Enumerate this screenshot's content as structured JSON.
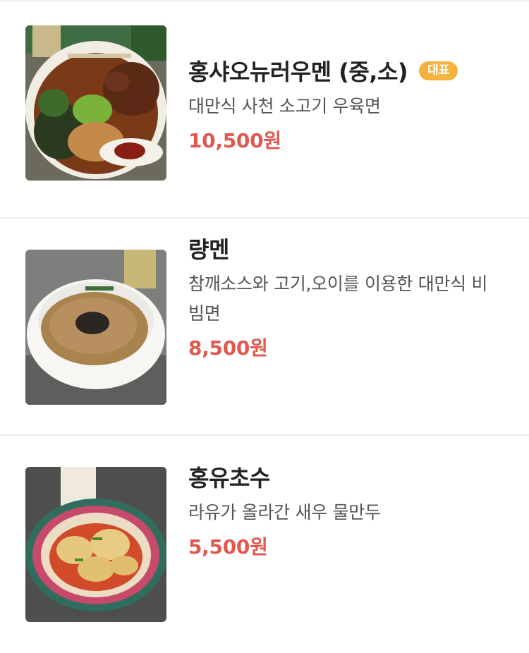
{
  "menu": {
    "items": [
      {
        "name": "홍샤오뉴러우멘 (중,소)",
        "badge": "대표",
        "description": "대만식 사천 소고기 우육면",
        "price": "10,500원",
        "image": "beef-noodle-soup-photo"
      },
      {
        "name": "량멘",
        "description": "참깨소스와 고기,오이를 이용한 대만식 비빔면",
        "price": "8,500원",
        "image": "sesame-cold-noodle-photo"
      },
      {
        "name": "홍유초수",
        "description": "라유가 올라간 새우 물만두",
        "price": "5,500원",
        "image": "chili-oil-shrimp-wonton-photo"
      }
    ]
  },
  "colors": {
    "price": "#e0584e",
    "badge": "#f5b23c",
    "name": "#222222",
    "description": "#555555",
    "divider": "#ececec"
  }
}
